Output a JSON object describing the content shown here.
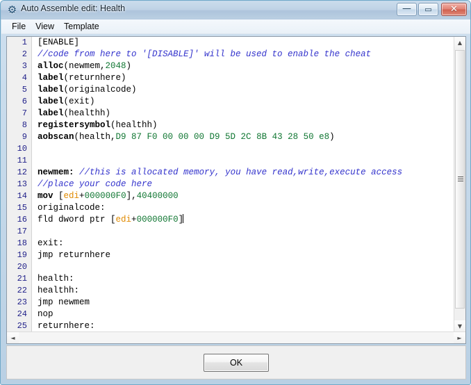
{
  "window": {
    "title": "Auto Assemble edit: Health",
    "icon": "cheat-engine-icon",
    "buttons": {
      "minimize": "—",
      "maximize": "▭",
      "close": "✕"
    }
  },
  "menubar": {
    "items": [
      {
        "label": "File"
      },
      {
        "label": "View"
      },
      {
        "label": "Template"
      }
    ]
  },
  "editor": {
    "line_numbers": [
      "1",
      "2",
      "3",
      "4",
      "5",
      "6",
      "7",
      "8",
      "9",
      "10",
      "11",
      "12",
      "13",
      "14",
      "15",
      "16",
      "17",
      "18",
      "19",
      "20",
      "21",
      "22",
      "23",
      "24",
      "25"
    ],
    "lines": [
      {
        "n": 1,
        "tokens": [
          {
            "t": "plain",
            "v": "[ENABLE]"
          }
        ]
      },
      {
        "n": 2,
        "tokens": [
          {
            "t": "comment",
            "v": "//code from here to '[DISABLE]' will be used to enable the cheat"
          }
        ]
      },
      {
        "n": 3,
        "tokens": [
          {
            "t": "kw",
            "v": "alloc"
          },
          {
            "t": "plain",
            "v": "(newmem,"
          },
          {
            "t": "num",
            "v": "2048"
          },
          {
            "t": "plain",
            "v": ")"
          }
        ]
      },
      {
        "n": 4,
        "tokens": [
          {
            "t": "kw",
            "v": "label"
          },
          {
            "t": "plain",
            "v": "(returnhere)"
          }
        ]
      },
      {
        "n": 5,
        "tokens": [
          {
            "t": "kw",
            "v": "label"
          },
          {
            "t": "plain",
            "v": "(originalcode)"
          }
        ]
      },
      {
        "n": 6,
        "tokens": [
          {
            "t": "kw",
            "v": "label"
          },
          {
            "t": "plain",
            "v": "(exit)"
          }
        ]
      },
      {
        "n": 7,
        "tokens": [
          {
            "t": "kw",
            "v": "label"
          },
          {
            "t": "plain",
            "v": "(healthh)"
          }
        ]
      },
      {
        "n": 8,
        "tokens": [
          {
            "t": "kw",
            "v": "registersymbol"
          },
          {
            "t": "plain",
            "v": "(healthh)"
          }
        ]
      },
      {
        "n": 9,
        "tokens": [
          {
            "t": "kw",
            "v": "aobscan"
          },
          {
            "t": "plain",
            "v": "(health,"
          },
          {
            "t": "num",
            "v": "D9 87 F0 00 00 00 D9 5D 2C 8B 43 28 50 e8"
          },
          {
            "t": "plain",
            "v": ")"
          }
        ]
      },
      {
        "n": 10,
        "tokens": []
      },
      {
        "n": 11,
        "tokens": []
      },
      {
        "n": 12,
        "tokens": [
          {
            "t": "kw",
            "v": "newmem:"
          },
          {
            "t": "plain",
            "v": " "
          },
          {
            "t": "comment",
            "v": "//this is allocated memory, you have read,write,execute access"
          }
        ]
      },
      {
        "n": 13,
        "tokens": [
          {
            "t": "comment",
            "v": "//place your code here"
          }
        ]
      },
      {
        "n": 14,
        "tokens": [
          {
            "t": "kw",
            "v": "mov"
          },
          {
            "t": "plain",
            "v": " ["
          },
          {
            "t": "reg",
            "v": "edi"
          },
          {
            "t": "plain",
            "v": "+"
          },
          {
            "t": "num",
            "v": "000000F0"
          },
          {
            "t": "plain",
            "v": "],"
          },
          {
            "t": "num",
            "v": "40400000"
          }
        ]
      },
      {
        "n": 15,
        "tokens": [
          {
            "t": "plain",
            "v": "originalcode:"
          }
        ]
      },
      {
        "n": 16,
        "tokens": [
          {
            "t": "plain",
            "v": "fld dword ptr ["
          },
          {
            "t": "reg",
            "v": "edi"
          },
          {
            "t": "plain",
            "v": "+"
          },
          {
            "t": "num",
            "v": "000000F0"
          },
          {
            "t": "plain",
            "v": "]"
          },
          {
            "t": "caret",
            "v": ""
          }
        ]
      },
      {
        "n": 17,
        "tokens": []
      },
      {
        "n": 18,
        "tokens": [
          {
            "t": "plain",
            "v": "exit:"
          }
        ]
      },
      {
        "n": 19,
        "tokens": [
          {
            "t": "plain",
            "v": "jmp returnhere"
          }
        ]
      },
      {
        "n": 20,
        "tokens": []
      },
      {
        "n": 21,
        "tokens": [
          {
            "t": "plain",
            "v": "health:"
          }
        ]
      },
      {
        "n": 22,
        "tokens": [
          {
            "t": "plain",
            "v": "healthh:"
          }
        ]
      },
      {
        "n": 23,
        "tokens": [
          {
            "t": "plain",
            "v": "jmp newmem"
          }
        ]
      },
      {
        "n": 24,
        "tokens": [
          {
            "t": "plain",
            "v": "nop"
          }
        ]
      },
      {
        "n": 25,
        "tokens": [
          {
            "t": "plain",
            "v": "returnhere:"
          }
        ]
      }
    ]
  },
  "scrollbars": {
    "vertical": {
      "up_arrow": "▲",
      "down_arrow": "▼"
    },
    "horizontal": {
      "left_arrow": "◄",
      "right_arrow": "►"
    }
  },
  "footer": {
    "ok_label": "OK"
  },
  "colors": {
    "title_bar": "#bbd0e4",
    "comment": "#3333cc",
    "number": "#117733",
    "register": "#e08a00",
    "keyword": "#000000",
    "gutter_number": "#22228a",
    "close_button": "#d0604f"
  }
}
